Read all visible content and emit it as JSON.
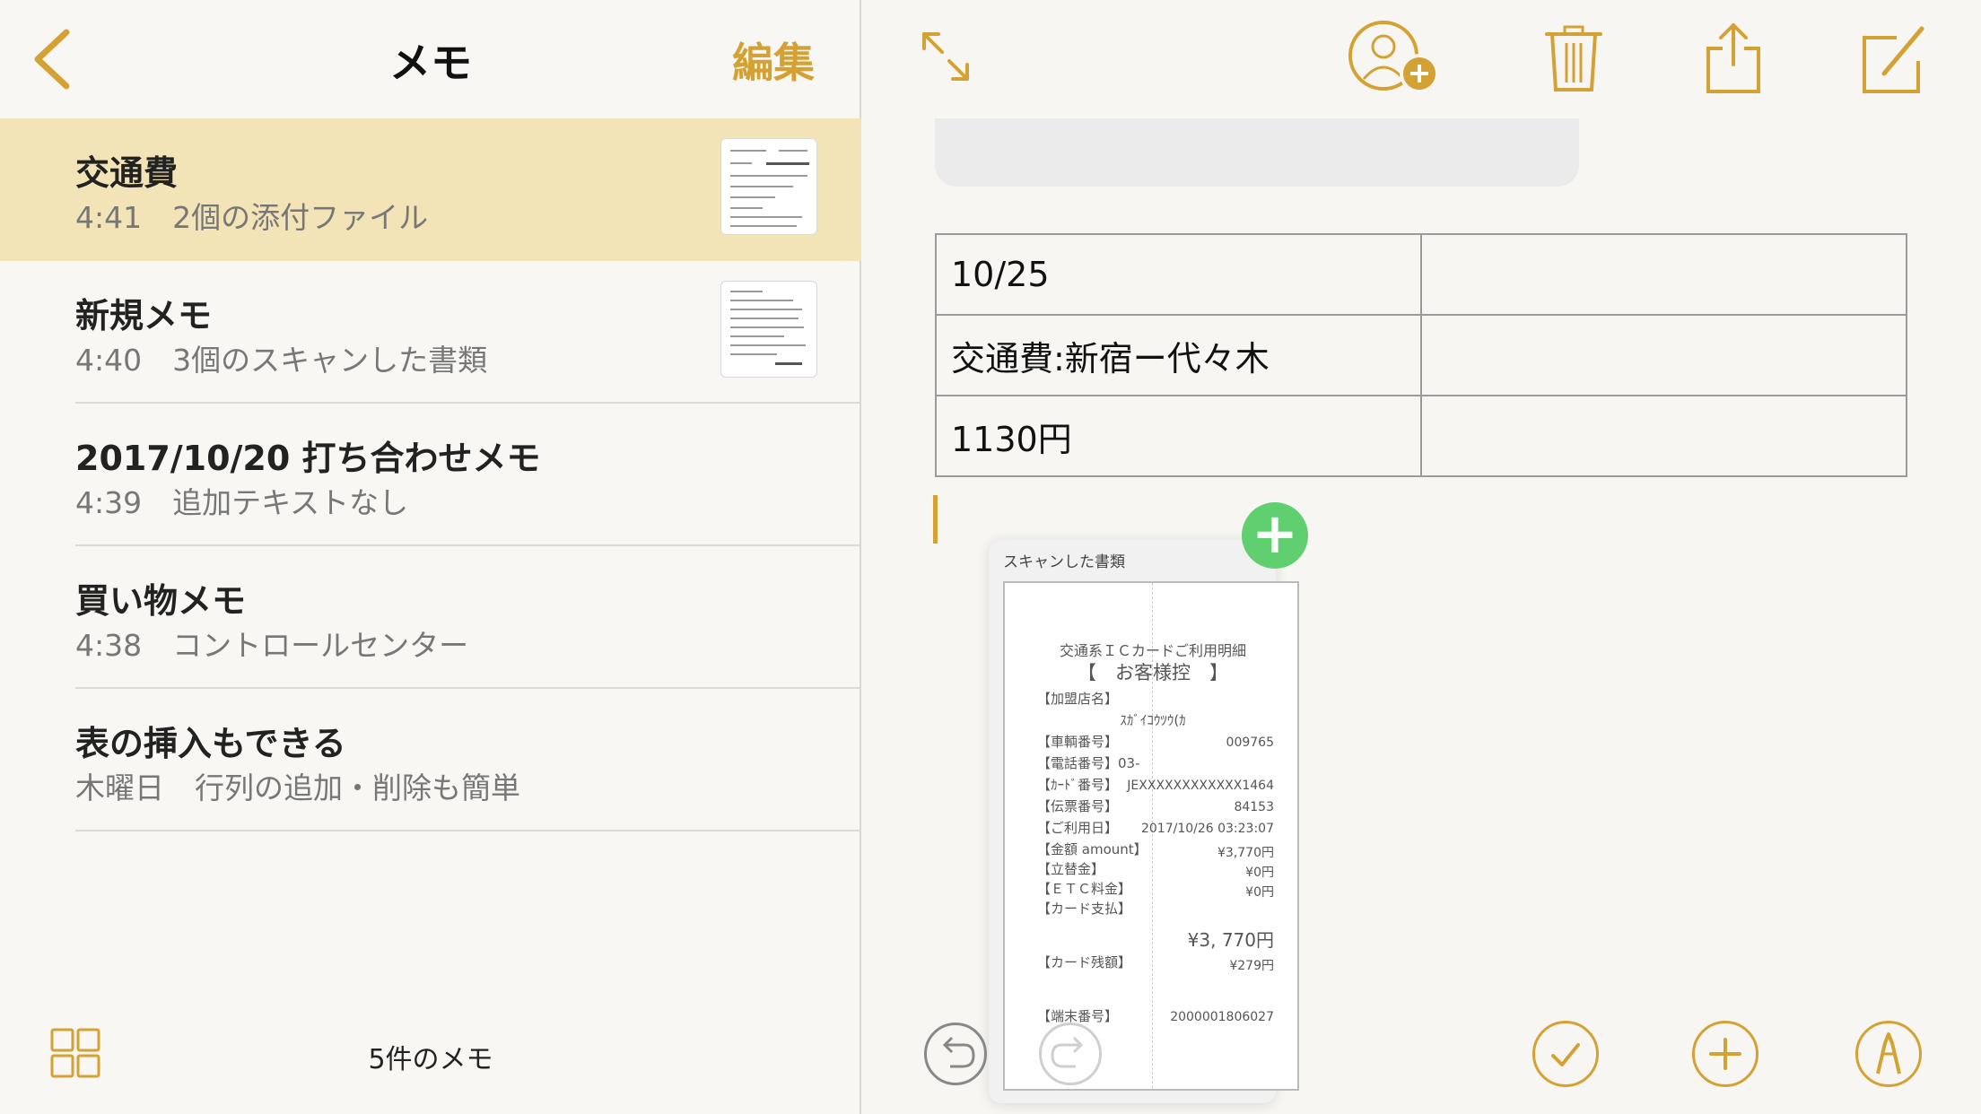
{
  "left": {
    "title": "メモ",
    "edit": "編集",
    "notes": [
      {
        "title": "交通費",
        "time": "4:41",
        "subtitle": "2個の添付ファイル",
        "selected": true
      },
      {
        "title": "新規メモ",
        "time": "4:40",
        "subtitle": "3個のスキャンした書類"
      },
      {
        "title": "2017/10/20 打ち合わせメモ",
        "time": "4:39",
        "subtitle": "追加テキストなし"
      },
      {
        "title": "買い物メモ",
        "time": "4:38",
        "subtitle": "コントロールセンター"
      },
      {
        "title": "表の挿入もできる",
        "time": "木曜日",
        "subtitle": "行列の追加・削除も簡単"
      }
    ],
    "count": "5件のメモ"
  },
  "table": [
    [
      "10/25",
      ""
    ],
    [
      "交通費:新宿ー代々木",
      ""
    ],
    [
      "1130円",
      ""
    ]
  ],
  "scan": {
    "label": "スキャンした書類",
    "receipt": {
      "header1": "交通系ＩＣカードご利用明細",
      "header2": "【　お客様控　】",
      "store_label": "【加盟店名】",
      "store_name": "ｽｶﾞｲｺｳﾂｳ(ｶ",
      "rows": [
        {
          "label": "【車輌番号】",
          "value": "009765"
        },
        {
          "label": "【電話番号】03-",
          "value": ""
        },
        {
          "label": "【ｶｰﾄﾞ番号】",
          "value": "JEXXXXXXXXXXXX1464"
        },
        {
          "label": "【伝票番号】",
          "value": "84153"
        },
        {
          "label": "【ご利用日】",
          "value": "2017/10/26 03:23:07"
        },
        {
          "label": "【金額 amount】",
          "value": "¥3,770円"
        },
        {
          "label": "【立替金】",
          "value": "¥0円"
        },
        {
          "label": "【ＥＴＣ料金】",
          "value": "¥0円"
        },
        {
          "label": "【カード支払】",
          "value": ""
        }
      ],
      "total": "¥3, 770円",
      "balance_label": "【カード残額】",
      "balance_value": "¥279円",
      "terminal_label": "【端末番号】",
      "terminal_value": "2000001806027"
    }
  },
  "colors": {
    "accent": "#d4a234",
    "selected_row": "#f3e4b7",
    "add_green": "#5fcf6f"
  }
}
